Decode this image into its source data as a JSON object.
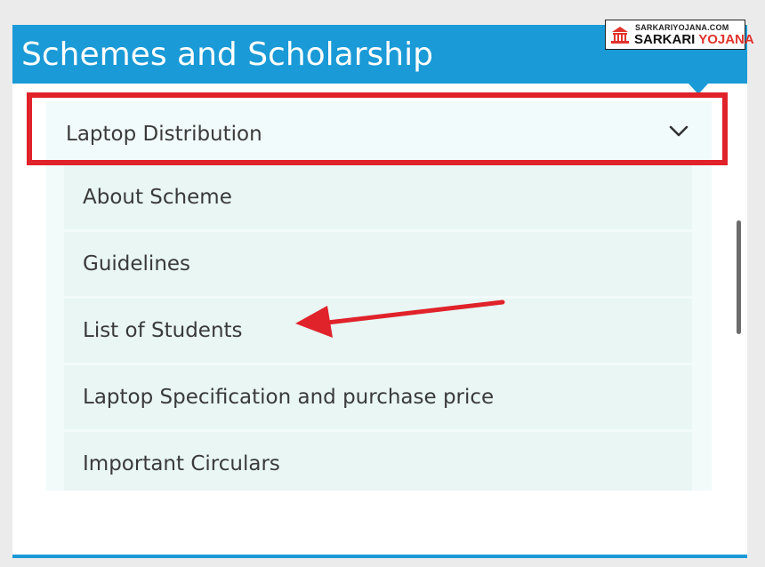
{
  "header": {
    "title": "Schemes and Scholarship"
  },
  "logo": {
    "top_text": "SARKARIYOJANA.COM",
    "bottom_text_1": "SARKARI",
    "bottom_text_2": "YOJANA"
  },
  "accordion": {
    "title": "Laptop Distribution",
    "items": [
      {
        "label": "About Scheme"
      },
      {
        "label": "Guidelines"
      },
      {
        "label": "List of Students"
      },
      {
        "label": "Laptop Specification and purchase price"
      },
      {
        "label": "Important Circulars"
      }
    ]
  },
  "colors": {
    "header_blue": "#1a9ad6",
    "highlight_red": "#e0222a",
    "item_bg": "#e9f6f3"
  }
}
